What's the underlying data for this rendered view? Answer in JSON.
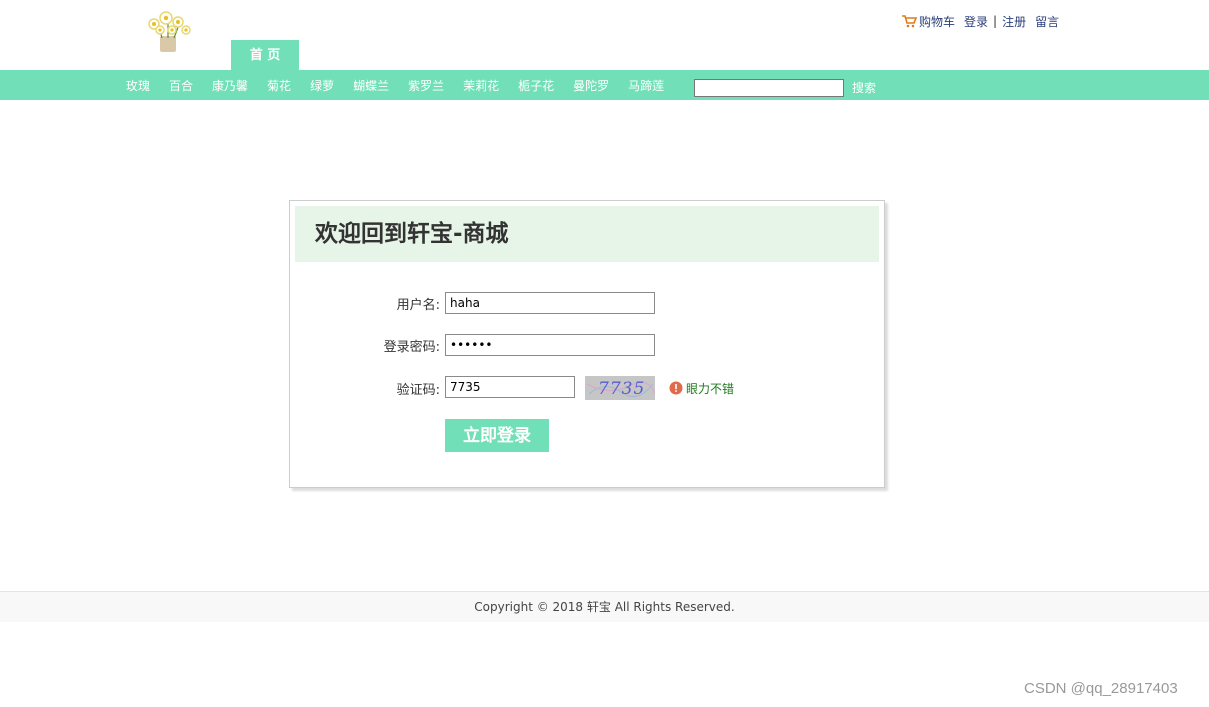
{
  "header": {
    "home_tab": "首 页",
    "links": {
      "cart": "购物车",
      "login": "登录",
      "separator": "|",
      "register": "注册",
      "message": "留言"
    }
  },
  "nav": {
    "items": [
      "玫瑰",
      "百合",
      "康乃馨",
      "菊花",
      "绿萝",
      "蝴蝶兰",
      "紫罗兰",
      "茉莉花",
      "栀子花",
      "曼陀罗",
      "马蹄莲"
    ],
    "search_value": "",
    "search_button": "搜索"
  },
  "login": {
    "title": "欢迎回到轩宝-商城",
    "username_label": "用户名:",
    "username_value": "haha",
    "password_label": "登录密码:",
    "password_value": "••••••",
    "captcha_label": "验证码:",
    "captcha_value": "7735",
    "captcha_image_text": "7735",
    "verify_message": "眼力不错",
    "submit": "立即登录"
  },
  "footer": {
    "copyright": "Copyright © 2018 轩宝 All Rights Reserved."
  },
  "watermark": "CSDN @qq_28917403",
  "colors": {
    "accent": "#71dfb7",
    "panel_head": "#e7f5e8",
    "link": "#2b3e7a",
    "success": "#1e7a1e"
  }
}
